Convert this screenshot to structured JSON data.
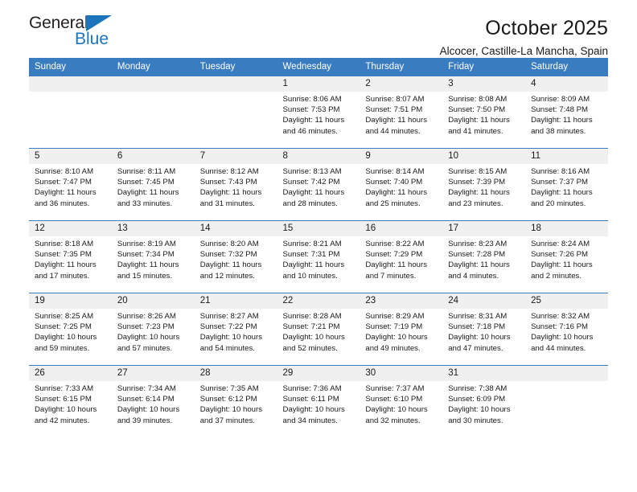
{
  "brand": {
    "name_top": "General",
    "name_bottom": "Blue",
    "triangle_color": "#1b75bb"
  },
  "header": {
    "title": "October 2025",
    "subtitle": "Alcocer, Castille-La Mancha, Spain"
  },
  "theme": {
    "header_bg": "#3a7cc0",
    "daynum_bg": "#f0f0f0",
    "text": "#1a1a1a"
  },
  "weekday_headers": [
    "Sunday",
    "Monday",
    "Tuesday",
    "Wednesday",
    "Thursday",
    "Friday",
    "Saturday"
  ],
  "weeks": [
    [
      {
        "day": "",
        "sunrise": "",
        "sunset": "",
        "daylight_line1": "",
        "daylight_line2": ""
      },
      {
        "day": "",
        "sunrise": "",
        "sunset": "",
        "daylight_line1": "",
        "daylight_line2": ""
      },
      {
        "day": "",
        "sunrise": "",
        "sunset": "",
        "daylight_line1": "",
        "daylight_line2": ""
      },
      {
        "day": "1",
        "sunrise": "Sunrise: 8:06 AM",
        "sunset": "Sunset: 7:53 PM",
        "daylight_line1": "Daylight: 11 hours",
        "daylight_line2": "and 46 minutes."
      },
      {
        "day": "2",
        "sunrise": "Sunrise: 8:07 AM",
        "sunset": "Sunset: 7:51 PM",
        "daylight_line1": "Daylight: 11 hours",
        "daylight_line2": "and 44 minutes."
      },
      {
        "day": "3",
        "sunrise": "Sunrise: 8:08 AM",
        "sunset": "Sunset: 7:50 PM",
        "daylight_line1": "Daylight: 11 hours",
        "daylight_line2": "and 41 minutes."
      },
      {
        "day": "4",
        "sunrise": "Sunrise: 8:09 AM",
        "sunset": "Sunset: 7:48 PM",
        "daylight_line1": "Daylight: 11 hours",
        "daylight_line2": "and 38 minutes."
      }
    ],
    [
      {
        "day": "5",
        "sunrise": "Sunrise: 8:10 AM",
        "sunset": "Sunset: 7:47 PM",
        "daylight_line1": "Daylight: 11 hours",
        "daylight_line2": "and 36 minutes."
      },
      {
        "day": "6",
        "sunrise": "Sunrise: 8:11 AM",
        "sunset": "Sunset: 7:45 PM",
        "daylight_line1": "Daylight: 11 hours",
        "daylight_line2": "and 33 minutes."
      },
      {
        "day": "7",
        "sunrise": "Sunrise: 8:12 AM",
        "sunset": "Sunset: 7:43 PM",
        "daylight_line1": "Daylight: 11 hours",
        "daylight_line2": "and 31 minutes."
      },
      {
        "day": "8",
        "sunrise": "Sunrise: 8:13 AM",
        "sunset": "Sunset: 7:42 PM",
        "daylight_line1": "Daylight: 11 hours",
        "daylight_line2": "and 28 minutes."
      },
      {
        "day": "9",
        "sunrise": "Sunrise: 8:14 AM",
        "sunset": "Sunset: 7:40 PM",
        "daylight_line1": "Daylight: 11 hours",
        "daylight_line2": "and 25 minutes."
      },
      {
        "day": "10",
        "sunrise": "Sunrise: 8:15 AM",
        "sunset": "Sunset: 7:39 PM",
        "daylight_line1": "Daylight: 11 hours",
        "daylight_line2": "and 23 minutes."
      },
      {
        "day": "11",
        "sunrise": "Sunrise: 8:16 AM",
        "sunset": "Sunset: 7:37 PM",
        "daylight_line1": "Daylight: 11 hours",
        "daylight_line2": "and 20 minutes."
      }
    ],
    [
      {
        "day": "12",
        "sunrise": "Sunrise: 8:18 AM",
        "sunset": "Sunset: 7:35 PM",
        "daylight_line1": "Daylight: 11 hours",
        "daylight_line2": "and 17 minutes."
      },
      {
        "day": "13",
        "sunrise": "Sunrise: 8:19 AM",
        "sunset": "Sunset: 7:34 PM",
        "daylight_line1": "Daylight: 11 hours",
        "daylight_line2": "and 15 minutes."
      },
      {
        "day": "14",
        "sunrise": "Sunrise: 8:20 AM",
        "sunset": "Sunset: 7:32 PM",
        "daylight_line1": "Daylight: 11 hours",
        "daylight_line2": "and 12 minutes."
      },
      {
        "day": "15",
        "sunrise": "Sunrise: 8:21 AM",
        "sunset": "Sunset: 7:31 PM",
        "daylight_line1": "Daylight: 11 hours",
        "daylight_line2": "and 10 minutes."
      },
      {
        "day": "16",
        "sunrise": "Sunrise: 8:22 AM",
        "sunset": "Sunset: 7:29 PM",
        "daylight_line1": "Daylight: 11 hours",
        "daylight_line2": "and 7 minutes."
      },
      {
        "day": "17",
        "sunrise": "Sunrise: 8:23 AM",
        "sunset": "Sunset: 7:28 PM",
        "daylight_line1": "Daylight: 11 hours",
        "daylight_line2": "and 4 minutes."
      },
      {
        "day": "18",
        "sunrise": "Sunrise: 8:24 AM",
        "sunset": "Sunset: 7:26 PM",
        "daylight_line1": "Daylight: 11 hours",
        "daylight_line2": "and 2 minutes."
      }
    ],
    [
      {
        "day": "19",
        "sunrise": "Sunrise: 8:25 AM",
        "sunset": "Sunset: 7:25 PM",
        "daylight_line1": "Daylight: 10 hours",
        "daylight_line2": "and 59 minutes."
      },
      {
        "day": "20",
        "sunrise": "Sunrise: 8:26 AM",
        "sunset": "Sunset: 7:23 PM",
        "daylight_line1": "Daylight: 10 hours",
        "daylight_line2": "and 57 minutes."
      },
      {
        "day": "21",
        "sunrise": "Sunrise: 8:27 AM",
        "sunset": "Sunset: 7:22 PM",
        "daylight_line1": "Daylight: 10 hours",
        "daylight_line2": "and 54 minutes."
      },
      {
        "day": "22",
        "sunrise": "Sunrise: 8:28 AM",
        "sunset": "Sunset: 7:21 PM",
        "daylight_line1": "Daylight: 10 hours",
        "daylight_line2": "and 52 minutes."
      },
      {
        "day": "23",
        "sunrise": "Sunrise: 8:29 AM",
        "sunset": "Sunset: 7:19 PM",
        "daylight_line1": "Daylight: 10 hours",
        "daylight_line2": "and 49 minutes."
      },
      {
        "day": "24",
        "sunrise": "Sunrise: 8:31 AM",
        "sunset": "Sunset: 7:18 PM",
        "daylight_line1": "Daylight: 10 hours",
        "daylight_line2": "and 47 minutes."
      },
      {
        "day": "25",
        "sunrise": "Sunrise: 8:32 AM",
        "sunset": "Sunset: 7:16 PM",
        "daylight_line1": "Daylight: 10 hours",
        "daylight_line2": "and 44 minutes."
      }
    ],
    [
      {
        "day": "26",
        "sunrise": "Sunrise: 7:33 AM",
        "sunset": "Sunset: 6:15 PM",
        "daylight_line1": "Daylight: 10 hours",
        "daylight_line2": "and 42 minutes."
      },
      {
        "day": "27",
        "sunrise": "Sunrise: 7:34 AM",
        "sunset": "Sunset: 6:14 PM",
        "daylight_line1": "Daylight: 10 hours",
        "daylight_line2": "and 39 minutes."
      },
      {
        "day": "28",
        "sunrise": "Sunrise: 7:35 AM",
        "sunset": "Sunset: 6:12 PM",
        "daylight_line1": "Daylight: 10 hours",
        "daylight_line2": "and 37 minutes."
      },
      {
        "day": "29",
        "sunrise": "Sunrise: 7:36 AM",
        "sunset": "Sunset: 6:11 PM",
        "daylight_line1": "Daylight: 10 hours",
        "daylight_line2": "and 34 minutes."
      },
      {
        "day": "30",
        "sunrise": "Sunrise: 7:37 AM",
        "sunset": "Sunset: 6:10 PM",
        "daylight_line1": "Daylight: 10 hours",
        "daylight_line2": "and 32 minutes."
      },
      {
        "day": "31",
        "sunrise": "Sunrise: 7:38 AM",
        "sunset": "Sunset: 6:09 PM",
        "daylight_line1": "Daylight: 10 hours",
        "daylight_line2": "and 30 minutes."
      },
      {
        "day": "",
        "sunrise": "",
        "sunset": "",
        "daylight_line1": "",
        "daylight_line2": ""
      }
    ]
  ]
}
